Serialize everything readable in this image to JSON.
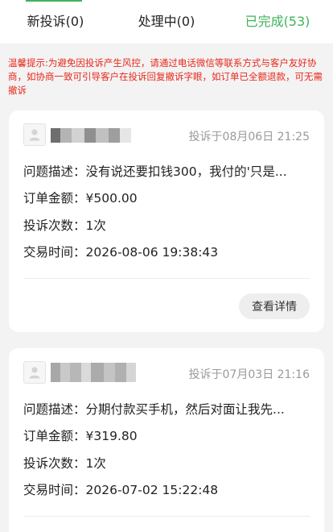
{
  "tabs": [
    {
      "label": "新投诉(0)"
    },
    {
      "label": "处理中(0)"
    },
    {
      "label": "已完成(53)"
    }
  ],
  "notice": "温馨提示:为避免因投诉产生风控，请通过电话微信等联系方式与客户友好协商，如协商一致可引导客户在投诉回复撤诉字眼，如订单已全额退款，可无需撤诉",
  "labels": {
    "problem": "问题描述：",
    "amount": "订单金额：",
    "count": "投诉次数：",
    "trade_time": "交易时间：",
    "detail_button": "查看详情"
  },
  "complaints": [
    {
      "submitted": "投诉于08月06日 21:25",
      "problem": "没有说还要扣钱300，我付的'只是...",
      "amount": "¥500.00",
      "count": "1次",
      "trade_time": "2026-08-06 19:38:43"
    },
    {
      "submitted": "投诉于07月03日 21:16",
      "problem": "分期付款买手机，然后对面让我先...",
      "amount": "¥319.80",
      "count": "1次",
      "trade_time": "2026-07-02 15:22:48"
    }
  ],
  "colors": {
    "accent": "#3fb35a",
    "notice": "#e8281c",
    "muted": "#9a9a9a"
  },
  "icons": {
    "avatar": "user-avatar-icon"
  }
}
